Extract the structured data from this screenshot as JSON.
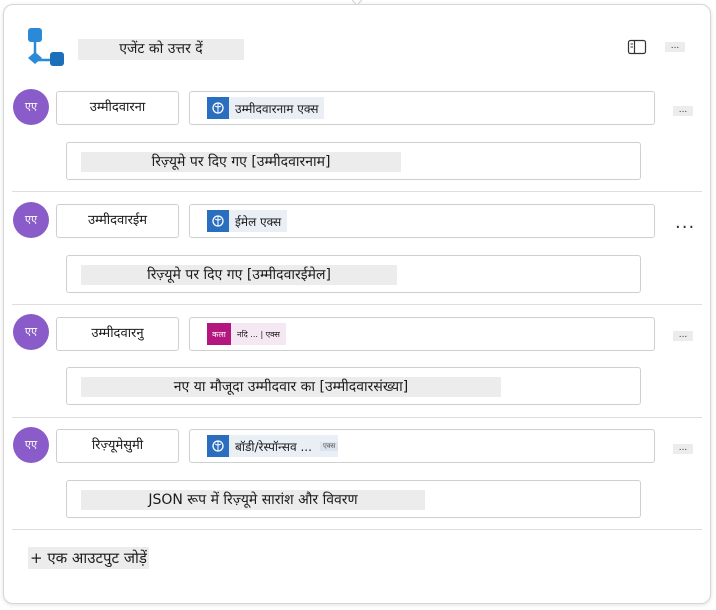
{
  "header": {
    "title": "एजेंट को उत्तर दें",
    "panel_icon": "side-panel-icon",
    "more_label": "..."
  },
  "colors": {
    "avatar": "#8a5cc9",
    "chip_icon": "#2a6fbf",
    "pink_badge": "#b3167f",
    "app_icon": "#2a8ad8"
  },
  "outputs": [
    {
      "avatar": "एए",
      "name": "उम्मीदवारना",
      "chip": "उम्मीदवारनाम एक्स",
      "description": "रिज़्यूमे पर दिए गए [उम्मीदवारनाम]",
      "more": "..."
    },
    {
      "avatar": "एए",
      "name": "उम्मीदवारईम",
      "chip": "ईमेल एक्स",
      "description": "रिज़्यूमे पर दिए गए [उम्मीदवारईमेल]",
      "more": "..."
    },
    {
      "avatar": "एए",
      "name": "उम्मीदवारनु",
      "chip_badge": "कला",
      "chip": "नदि ... | एक्स",
      "description": "नए या मौजूदा उम्मीदवार का [उम्मीदवारसंख्या]",
      "more": "..."
    },
    {
      "avatar": "एए",
      "name": "रिज़्यूमेसुमी",
      "chip": "बॉडी/रेस्पॉन्सव ...",
      "chip_tag": "एक्स",
      "description": "JSON रूप में रिज़्यूमे सारांश और विवरण",
      "more": "..."
    }
  ],
  "footer": {
    "add_output": "+ एक आउटपुट जोड़ें"
  }
}
